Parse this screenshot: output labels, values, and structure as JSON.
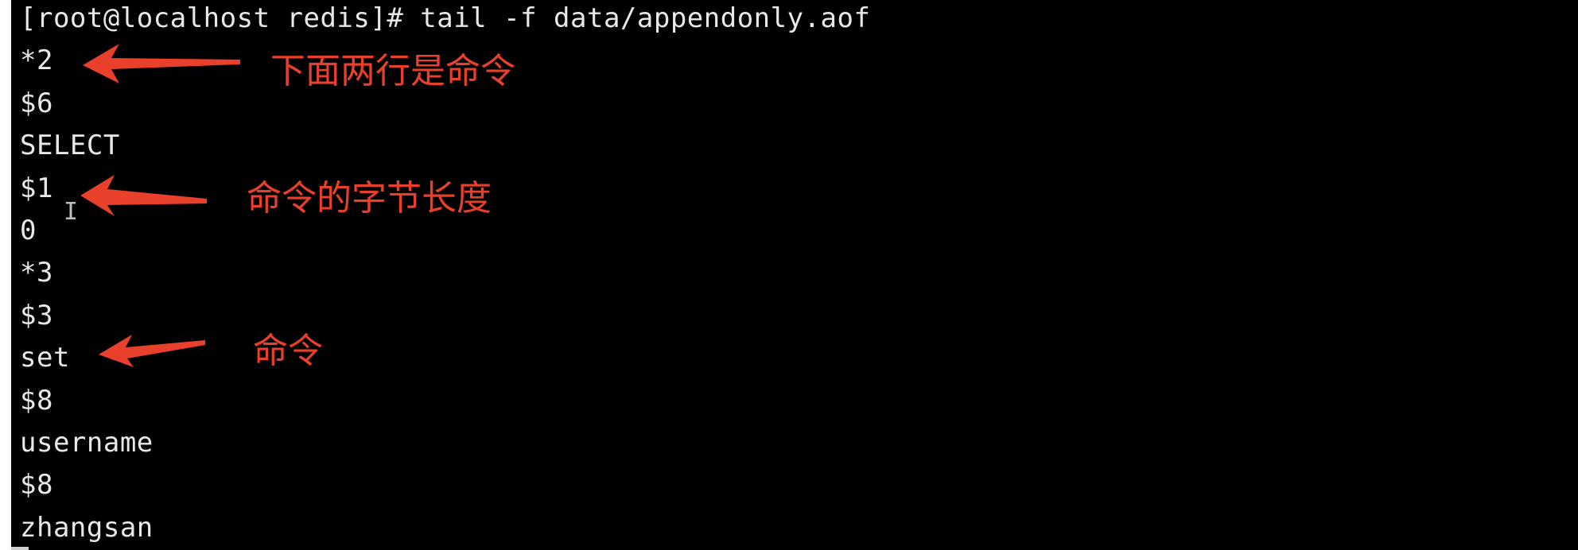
{
  "terminal": {
    "lines": [
      "[root@localhost redis]# tail -f data/appendonly.aof",
      "*2",
      "$6",
      "SELECT",
      "$1",
      "0",
      "*3",
      "$3",
      "set",
      "$8",
      "username",
      "$8",
      "zhangsan"
    ]
  },
  "annotations": {
    "color": "#e8402a",
    "note_1": "下面两行是命令",
    "note_2": "命令的字节长度",
    "note_3": "命令"
  },
  "colors": {
    "background": "#000000",
    "text": "#e8e8e8",
    "annotation": "#e8402a"
  }
}
